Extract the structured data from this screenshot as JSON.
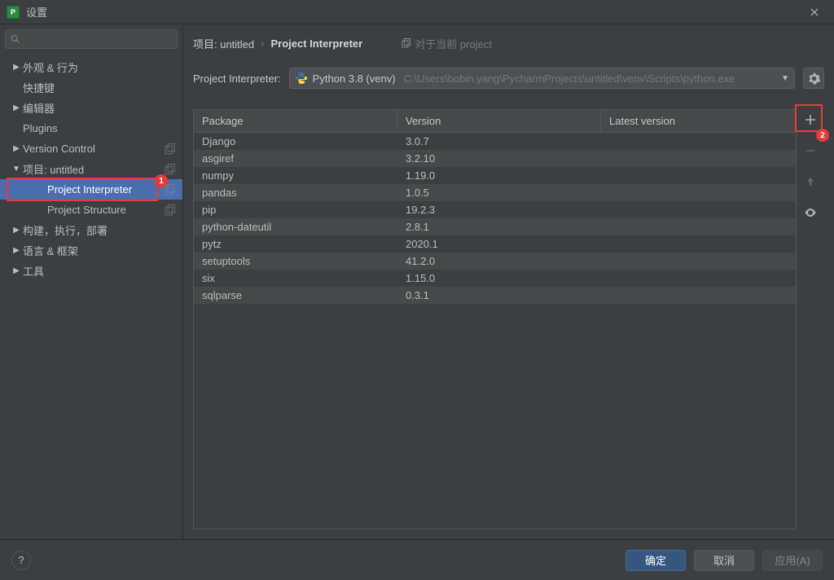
{
  "window": {
    "title": "设置"
  },
  "search": {
    "placeholder": ""
  },
  "sidebar": {
    "items": [
      {
        "label": "外观 & 行为",
        "arrow": "▶",
        "child": false,
        "copy": false
      },
      {
        "label": "快捷键",
        "arrow": "",
        "child": false,
        "copy": false
      },
      {
        "label": "编辑器",
        "arrow": "▶",
        "child": false,
        "copy": false
      },
      {
        "label": "Plugins",
        "arrow": "",
        "child": false,
        "copy": false
      },
      {
        "label": "Version Control",
        "arrow": "▶",
        "child": false,
        "copy": true
      },
      {
        "label": "项目: untitled",
        "arrow": "▼",
        "child": false,
        "copy": true
      },
      {
        "label": "Project Interpreter",
        "arrow": "",
        "child": true,
        "copy": true,
        "selected": true
      },
      {
        "label": "Project Structure",
        "arrow": "",
        "child": true,
        "copy": true
      },
      {
        "label": "构建，执行，部署",
        "arrow": "▶",
        "child": false,
        "copy": false
      },
      {
        "label": "语言 & 框架",
        "arrow": "▶",
        "child": false,
        "copy": false
      },
      {
        "label": "工具",
        "arrow": "▶",
        "child": false,
        "copy": false
      }
    ]
  },
  "breadcrumb": {
    "seg1": "项目: untitled",
    "sep": "›",
    "seg2": "Project Interpreter",
    "scope": "对于当前 project"
  },
  "interpreter": {
    "label": "Project Interpreter:",
    "name": "Python 3.8 (venv)",
    "path": "C:\\Users\\bobin.yang\\PycharmProjects\\untitled\\venv\\Scripts\\python.exe"
  },
  "table": {
    "headers": {
      "package": "Package",
      "version": "Version",
      "latest": "Latest version"
    },
    "rows": [
      {
        "pkg": "Django",
        "ver": "3.0.7",
        "lat": ""
      },
      {
        "pkg": "asgiref",
        "ver": "3.2.10",
        "lat": ""
      },
      {
        "pkg": "numpy",
        "ver": "1.19.0",
        "lat": ""
      },
      {
        "pkg": "pandas",
        "ver": "1.0.5",
        "lat": ""
      },
      {
        "pkg": "pip",
        "ver": "19.2.3",
        "lat": ""
      },
      {
        "pkg": "python-dateutil",
        "ver": "2.8.1",
        "lat": ""
      },
      {
        "pkg": "pytz",
        "ver": "2020.1",
        "lat": ""
      },
      {
        "pkg": "setuptools",
        "ver": "41.2.0",
        "lat": ""
      },
      {
        "pkg": "six",
        "ver": "1.15.0",
        "lat": ""
      },
      {
        "pkg": "sqlparse",
        "ver": "0.3.1",
        "lat": ""
      }
    ]
  },
  "annotations": {
    "badge1": "1",
    "badge2": "2"
  },
  "footer": {
    "ok": "确定",
    "cancel": "取消",
    "apply": "应用(A)"
  }
}
